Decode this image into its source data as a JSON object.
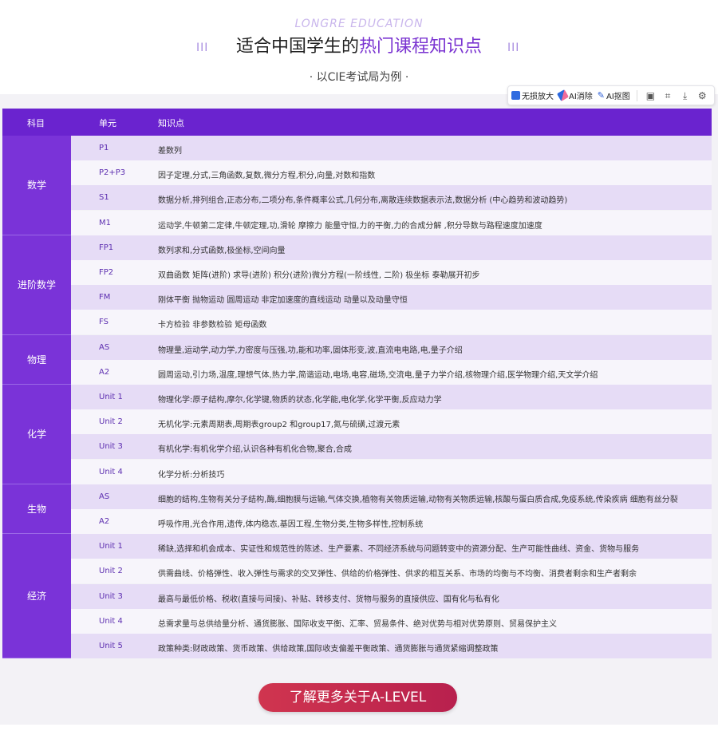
{
  "header": {
    "subtitle_en": "LONGRE   EDUCATION",
    "title_prefix": "适合中国学生的",
    "title_highlight": "热门课程知识点",
    "deco_left": "III",
    "deco_right": "III",
    "exam_board": "· 以CIE考试局为例 ·"
  },
  "toolbar": {
    "lossless_zoom": "无损放大",
    "ai_eraser": "AI消除",
    "ai_cutout": "AI抠图"
  },
  "table": {
    "headers": {
      "subject": "科目",
      "unit": "单元",
      "point": "知识点"
    },
    "subjects": [
      {
        "name": "数学",
        "rows": [
          {
            "unit": "P1",
            "point": "差数列"
          },
          {
            "unit": "P2+P3",
            "point": "因子定理,分式,三角函数,复数,微分方程,积分,向量,对数和指数"
          },
          {
            "unit": "S1",
            "point": "数据分析,排列组合,正态分布,二项分布,条件概率公式,几何分布,离散连续数据表示法,数据分析 (中心趋势和波动趋势)"
          },
          {
            "unit": "M1",
            "point": "运动学,牛顿第二定律,牛顿定理,功,滑轮 摩擦力 能量守恒,力的平衡,力的合成分解 ,积分导数与路程速度加速度"
          }
        ]
      },
      {
        "name": "进阶数学",
        "rows": [
          {
            "unit": "FP1",
            "point": "数列求和,分式函数,极坐标,空间向量"
          },
          {
            "unit": "FP2",
            "point": "双曲函数 矩阵(进阶) 求导(进阶) 积分(进阶)微分方程(一阶线性, 二阶) 极坐标 泰勒展开初步"
          },
          {
            "unit": "FM",
            "point": "刚体平衡 抛物运动 圆周运动 非定加速度的直线运动 动量以及动量守恒"
          },
          {
            "unit": "FS",
            "point": "卡方检验 非参数检验 矩母函数"
          }
        ]
      },
      {
        "name": "物理",
        "rows": [
          {
            "unit": "AS",
            "point": "物理量,运动学,动力学,力密度与压强,功,能和功率,固体形变,波,直流电电路,电,量子介绍"
          },
          {
            "unit": "A2",
            "point": "圆周运动,引力场,温度,理想气体,热力学,简谐运动,电场,电容,磁场,交流电,量子力学介绍,核物理介绍,医学物理介绍,天文学介绍"
          }
        ]
      },
      {
        "name": "化学",
        "rows": [
          {
            "unit": "Unit 1",
            "point": " 物理化学:原子结构,摩尔,化学键,物质的状态,化学能,电化学,化学平衡,反应动力学"
          },
          {
            "unit": "Unit 2",
            "point": " 无机化学:元素周期表,周期表group2 和group17,氮与硫磺,过渡元素"
          },
          {
            "unit": "Unit 3",
            "point": " 有机化学:有机化学介绍,认识各种有机化合物,聚合,合成"
          },
          {
            "unit": "Unit 4",
            "point": "化学分析:分析技巧"
          }
        ]
      },
      {
        "name": "生物",
        "rows": [
          {
            "unit": "AS",
            "point": "细胞的结构,生物有关分子结构,酶,细胞膜与运输,气体交换,植物有关物质运输,动物有关物质运输,核酸与蛋白质合成,免疫系统,传染疾病 细胞有丝分裂"
          },
          {
            "unit": "A2",
            "point": "呼吸作用,光合作用,遗传,体内稳态,基因工程,生物分类,生物多样性,控制系统"
          }
        ]
      },
      {
        "name": "经济",
        "rows": [
          {
            "unit": "Unit 1",
            "point": "稀缺,选择和机会成本、实证性和规范性的陈述、生产要素、不同经济系统与问题转变中的资源分配、生产可能性曲线、资金、货物与服务"
          },
          {
            "unit": "Unit 2",
            "point": "供需曲线、价格弹性、收入弹性与需求的交叉弹性、供给的价格弹性、供求的相互关系、市场的均衡与不均衡、消费者剩余和生产者剩余"
          },
          {
            "unit": "Unit 3",
            "point": "最高与最低价格、税收(直接与间接)、补贴、转移支付、货物与服务的直接供应、国有化与私有化"
          },
          {
            "unit": "Unit 4",
            "point": "总需求量与总供给量分析、通货膨胀、国际收支平衡、汇率、贸易条件、绝对优势与相对优势原则、贸易保护主义"
          },
          {
            "unit": "Unit 5",
            "point": "政策种类:财政政策、货币政策、供给政策,国际收支偏差平衡政策、通货膨胀与通货紧缩调整政策"
          }
        ]
      }
    ]
  },
  "cta": {
    "label": "了解更多关于A-LEVEL"
  },
  "colors": {
    "accent": "#6a23cf",
    "subject_bg": "#7a33d8",
    "row_odd": "#e6dcf6",
    "row_even": "#f7f5fb",
    "cta": "#c52a4f"
  }
}
